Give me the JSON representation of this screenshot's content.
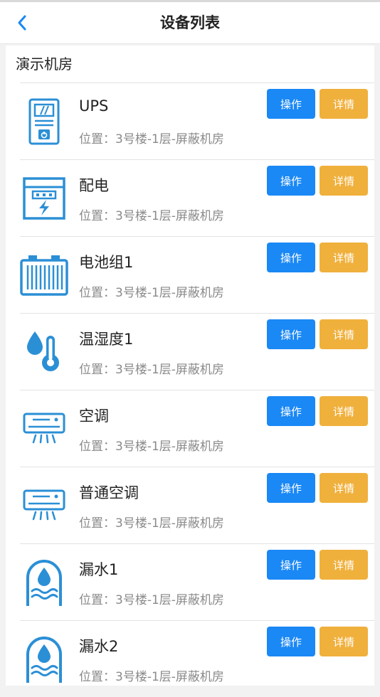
{
  "header": {
    "title": "设备列表",
    "back_icon": "chevron-left-icon"
  },
  "section": {
    "title": "演示机房"
  },
  "colors": {
    "accent": "#1a88f5",
    "detail": "#f0b03c",
    "icon": "#2b8fd6"
  },
  "devices": [
    {
      "name": "UPS",
      "location": "位置：3号楼-1层-屏蔽机房",
      "icon": "ups-icon",
      "op_label": "操作",
      "detail_label": "详情"
    },
    {
      "name": "配电",
      "location": "位置：3号楼-1层-屏蔽机房",
      "icon": "power-distribution-icon",
      "op_label": "操作",
      "detail_label": "详情"
    },
    {
      "name": "电池组1",
      "location": "位置：3号楼-1层-屏蔽机房",
      "icon": "battery-icon",
      "op_label": "操作",
      "detail_label": "详情"
    },
    {
      "name": "温湿度1",
      "location": "位置：3号楼-1层-屏蔽机房",
      "icon": "temperature-humidity-icon",
      "op_label": "操作",
      "detail_label": "详情"
    },
    {
      "name": "空调",
      "location": "位置：3号楼-1层-屏蔽机房",
      "icon": "air-conditioner-icon",
      "op_label": "操作",
      "detail_label": "详情"
    },
    {
      "name": "普通空调",
      "location": "位置：3号楼-1层-屏蔽机房",
      "icon": "air-conditioner-icon",
      "op_label": "操作",
      "detail_label": "详情"
    },
    {
      "name": "漏水1",
      "location": "位置：3号楼-1层-屏蔽机房",
      "icon": "water-leak-icon",
      "op_label": "操作",
      "detail_label": "详情"
    },
    {
      "name": "漏水2",
      "location": "位置：3号楼-1层-屏蔽机房",
      "icon": "water-leak-icon",
      "op_label": "操作",
      "detail_label": "详情"
    }
  ]
}
